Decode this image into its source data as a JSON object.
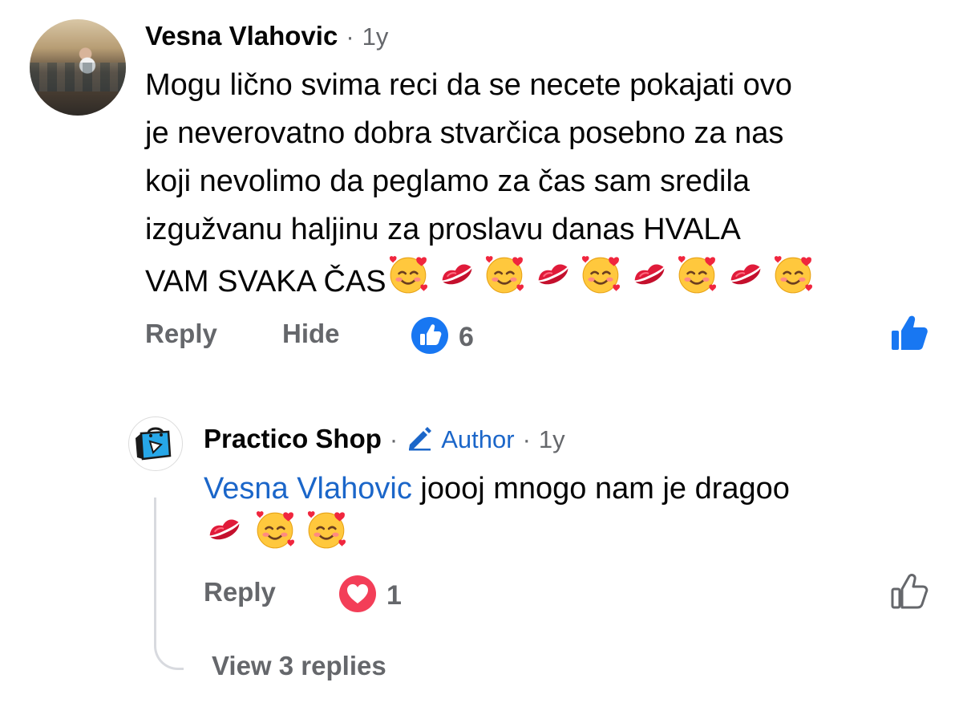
{
  "comment": {
    "author": "Vesna Vlahovic",
    "separator": "·",
    "time": "1y",
    "lines": [
      "Mogu lično svima reci da se necete pokajati ovo",
      "je neverovatno dobra stvarčica posebno za nas",
      "koji nevolimo da peglamo za čas sam sredila",
      "izgužvanu haljinu za proslavu danas HVALA"
    ],
    "last_line_text": "VAM SVAKA ČAS",
    "emoji_sequence": [
      "smiling-hearts-emoji",
      "kiss-mark-emoji",
      "smiling-hearts-emoji",
      "kiss-mark-emoji",
      "smiling-hearts-emoji",
      "kiss-mark-emoji",
      "smiling-hearts-emoji",
      "kiss-mark-emoji",
      "smiling-hearts-emoji"
    ],
    "reply_label": "Reply",
    "hide_label": "Hide",
    "reaction_count": "6",
    "like_color": "#1877f2"
  },
  "reply": {
    "author": "Practico Shop",
    "separator1": "·",
    "author_badge": "Author",
    "separator2": "·",
    "time": "1y",
    "mention": "Vesna Vlahovic",
    "text": " joooj mnogo nam je dragoo",
    "emoji_sequence": [
      "kiss-mark-emoji",
      "smiling-hearts-emoji",
      "smiling-hearts-emoji"
    ],
    "reply_label": "Reply",
    "reaction_count": "1",
    "love_color": "#f33e58",
    "view_replies": "View 3 replies"
  }
}
